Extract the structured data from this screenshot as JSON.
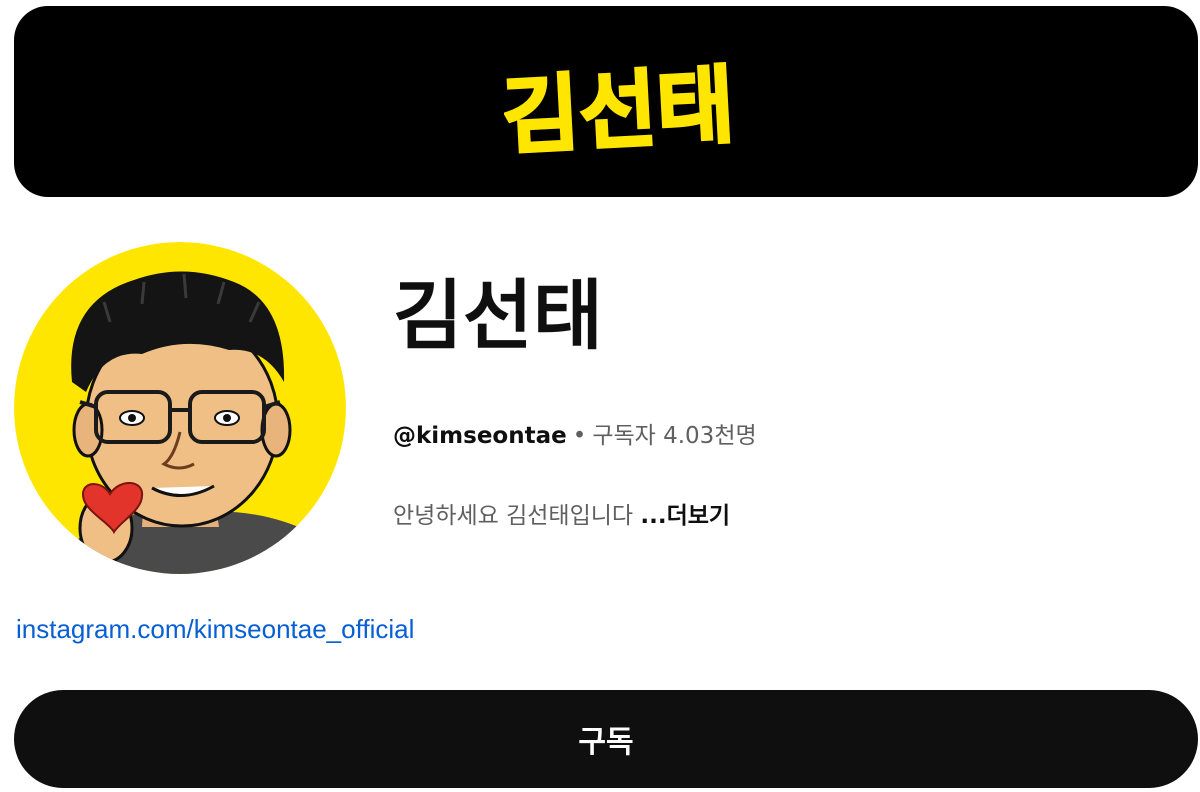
{
  "banner": {
    "logo_text": "김선태",
    "logo_color": "#ffe600",
    "background": "#000000"
  },
  "avatar": {
    "icon": "avatar-illustration",
    "background": "#ffe600"
  },
  "channel": {
    "name": "김선태",
    "handle": "@kimseontae",
    "separator": "•",
    "subscribers": "구독자 4.03천명",
    "description": "안녕하세요 김선태입니다",
    "more_label": "...더보기",
    "link": "instagram.com/kimseontae_official"
  },
  "subscribe": {
    "label": "구독"
  },
  "colors": {
    "link": "#065fd4",
    "text_primary": "#0f0f0f",
    "text_secondary": "#606060",
    "button": "#0f0f0f"
  }
}
